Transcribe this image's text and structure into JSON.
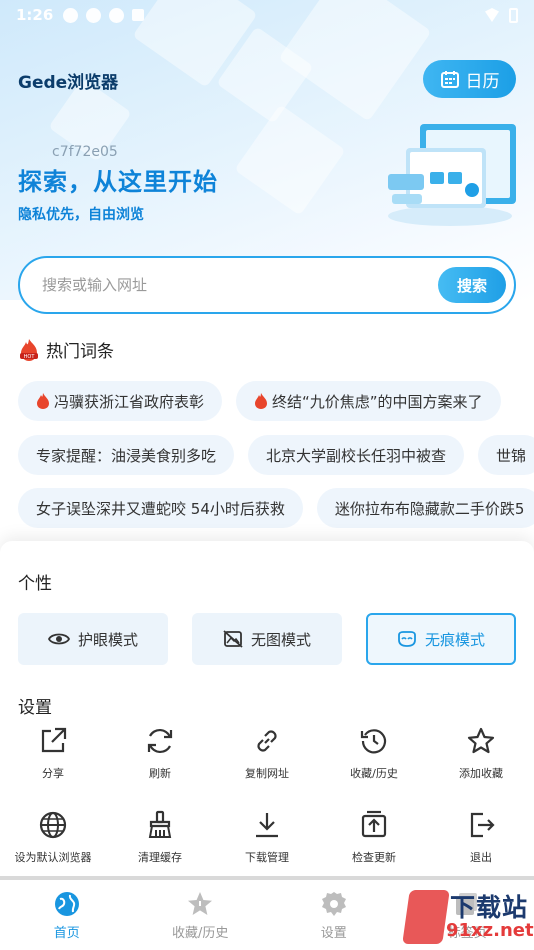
{
  "status_bar": {
    "time": "1:26"
  },
  "header": {
    "app_title": "Gede浏览器",
    "calendar_label": "日历"
  },
  "hero": {
    "code": "c7f72e05",
    "title": "探索，从这里开始",
    "subtitle": "隐私优先，自由浏览"
  },
  "search": {
    "placeholder": "搜索或输入网址",
    "button": "搜索"
  },
  "hot": {
    "title": "热门词条",
    "rows": [
      [
        "冯骥获浙江省政府表彰",
        "终结“九价焦虑”的中国方案来了"
      ],
      [
        "专家提醒：油浸美食别多吃",
        "北京大学副校长任羽中被查",
        "世锦"
      ],
      [
        "女子误坠深井又遭蛇咬 54小时后获救",
        "迷你拉布布隐藏款二手价跌5"
      ]
    ]
  },
  "sheet": {
    "personal_title": "个性",
    "modes": [
      "护眼模式",
      "无图模式",
      "无痕模式"
    ],
    "settings_title": "设置",
    "items": [
      "分享",
      "刷新",
      "复制网址",
      "收藏/历史",
      "添加收藏",
      "设为默认浏览器",
      "清理缓存",
      "下载管理",
      "检查更新",
      "退出"
    ]
  },
  "tabbar": [
    "首页",
    "收藏/历史",
    "设置",
    "标签页"
  ],
  "watermark": {
    "line1": "下载站",
    "line2": "91xz.net"
  },
  "colors": {
    "accent": "#1996e0",
    "hot_red": "#e8452c"
  }
}
